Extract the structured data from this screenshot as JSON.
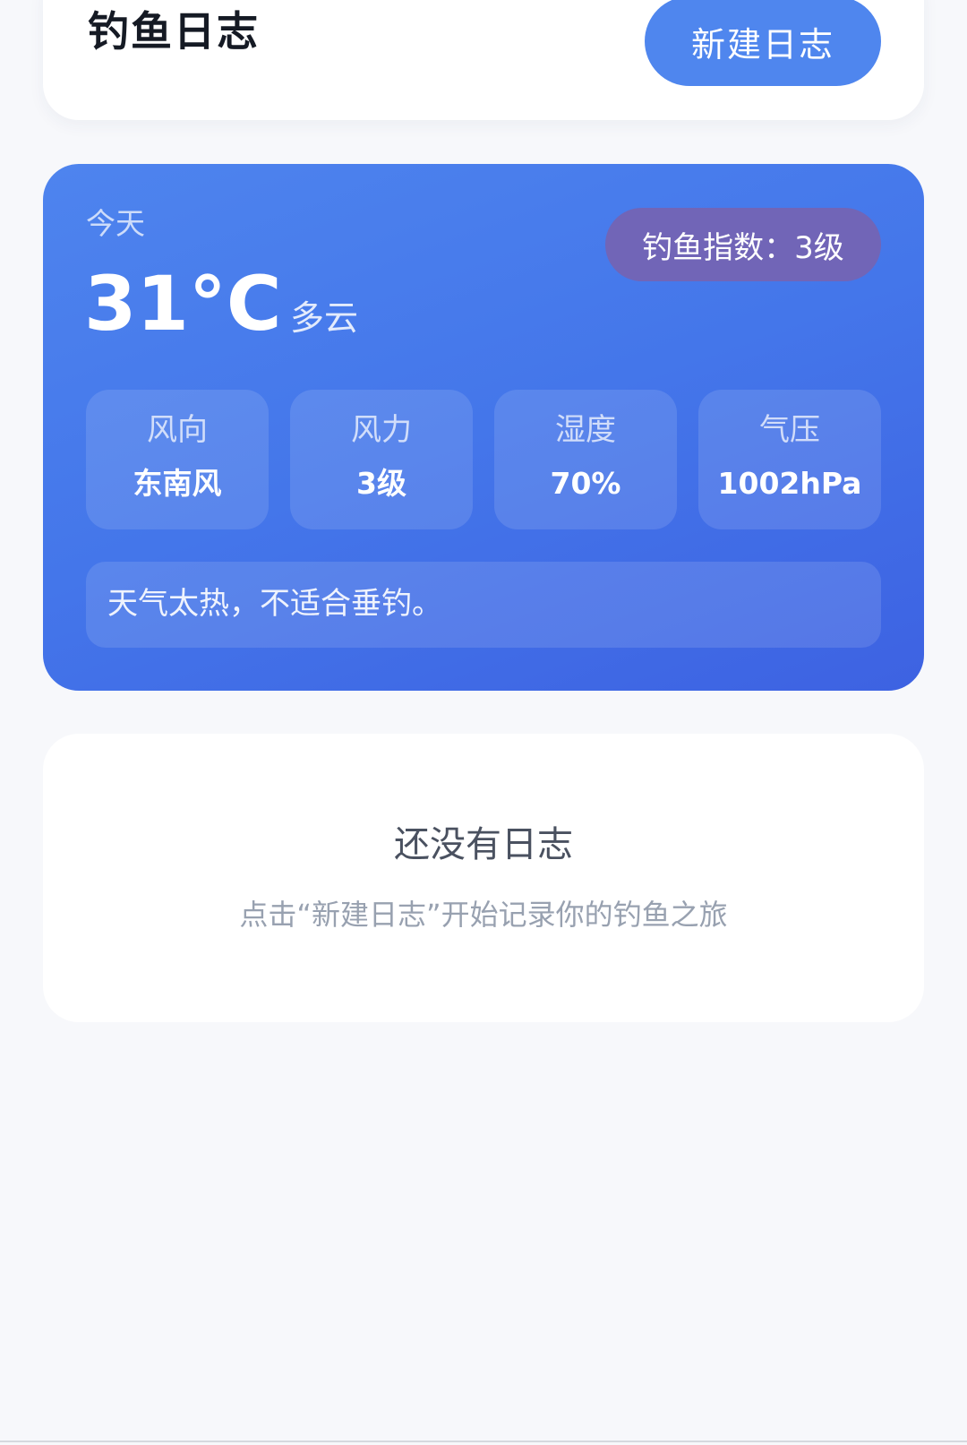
{
  "header": {
    "title": "钓鱼日志",
    "new_log_label": "新建日志"
  },
  "weather": {
    "day": "今天",
    "temperature": "31°C",
    "condition": "多云",
    "fishing_index": "钓鱼指数：3级",
    "stats": [
      {
        "label": "风向",
        "value": "东南风"
      },
      {
        "label": "风力",
        "value": "3级"
      },
      {
        "label": "湿度",
        "value": "70%"
      },
      {
        "label": "气压",
        "value": "1002hPa"
      }
    ],
    "advice": "天气太热，不适合垂钓。"
  },
  "empty_state": {
    "title": "还没有日志",
    "subtitle": "点击“新建日志”开始记录你的钓鱼之旅"
  },
  "colors": {
    "accent": "#4f86ee",
    "weather_card_start": "#4e84ee",
    "weather_card_end": "#3d62e2",
    "badge": "#7165b7",
    "background": "#f7f8fb"
  }
}
